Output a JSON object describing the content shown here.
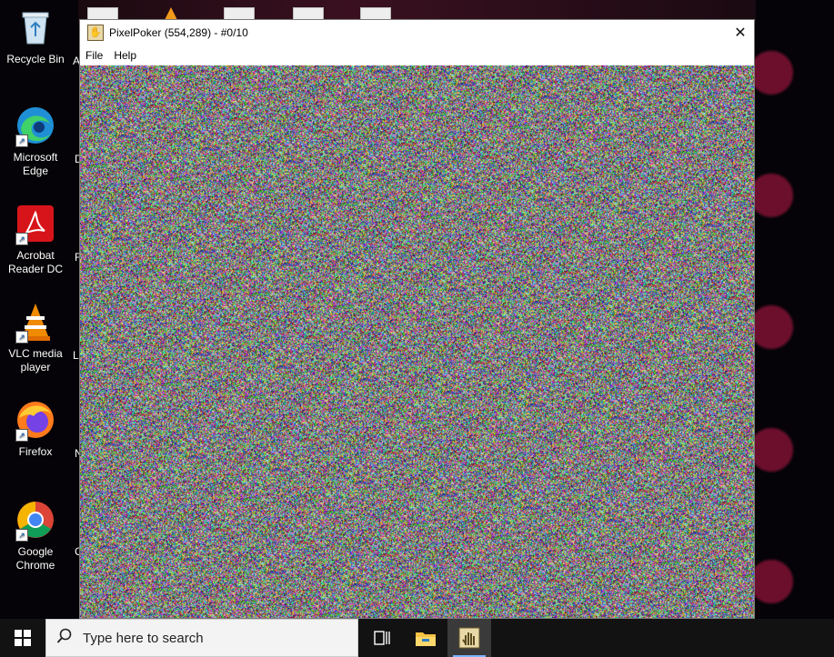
{
  "desktop": {
    "icons": [
      {
        "label": "Recycle Bin",
        "icon": "recycle-bin-icon"
      },
      {
        "label": "Microsoft Edge",
        "icon": "edge-icon"
      },
      {
        "label": "Acrobat Reader DC",
        "icon": "acrobat-icon"
      },
      {
        "label": "VLC media player",
        "icon": "vlc-icon"
      },
      {
        "label": "Firefox",
        "icon": "firefox-icon"
      },
      {
        "label": "Google Chrome",
        "icon": "chrome-icon"
      }
    ],
    "cut_labels": [
      "A",
      "D",
      "F",
      "L",
      "N",
      "C"
    ]
  },
  "window": {
    "title": "PixelPoker (554,289) - #0/10",
    "menu": [
      "File",
      "Help"
    ],
    "close_glyph": "✕"
  },
  "taskbar": {
    "search_placeholder": "Type here to search",
    "search_icon": "magnifier-icon",
    "buttons": [
      "task-view-icon",
      "file-explorer-icon",
      "pixelpoker-app-icon"
    ]
  }
}
